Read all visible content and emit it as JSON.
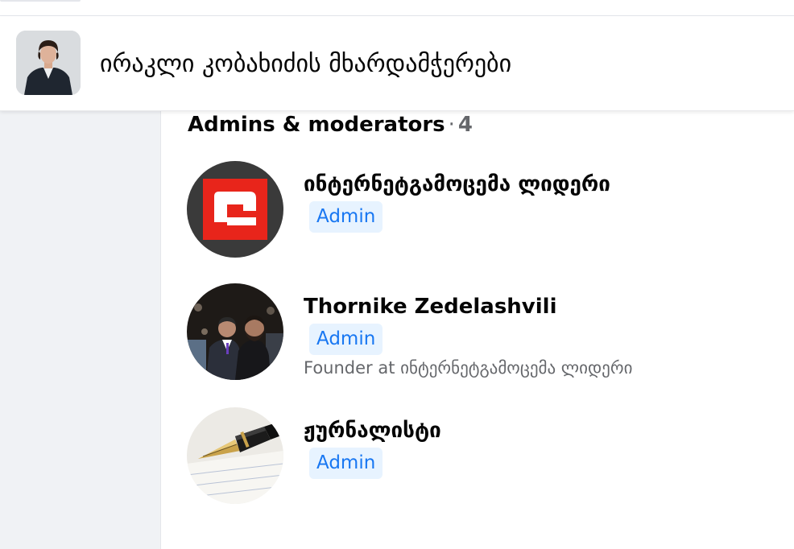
{
  "group": {
    "name": "ირაკლი კობახიძის მხარდამჭერები"
  },
  "section": {
    "title": "Admins & moderators",
    "separator": "·",
    "count": "4"
  },
  "members": [
    {
      "name": "ინტერნეტგამოცემა ლიდერი",
      "role": "Admin",
      "subtitle": "",
      "avatar_icon": "leader-logo-icon",
      "colors": {
        "bg": "#3a3a3a",
        "accent": "#e8251b"
      }
    },
    {
      "name": "Thornike Zedelashvili",
      "role": "Admin",
      "subtitle": "Founder at ინტერნეტგამოცემა ლიდერი",
      "avatar_icon": "person-photo-icon"
    },
    {
      "name": "ჟურნალისტი",
      "role": "Admin",
      "subtitle": "",
      "avatar_icon": "fountain-pen-icon"
    }
  ],
  "colors": {
    "badge_bg": "#e7f3ff",
    "badge_text": "#1877f2",
    "secondary_text": "#65676b",
    "rail": "#f0f2f5"
  }
}
